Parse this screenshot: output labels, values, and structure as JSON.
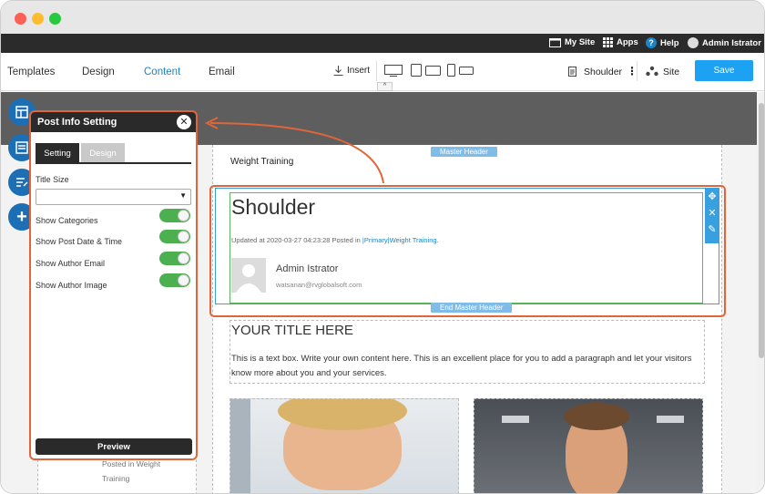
{
  "adminbar": {
    "mysite": "My Site",
    "apps": "Apps",
    "help": "Help",
    "user": "Admin Istrator"
  },
  "toolbar": {
    "tabs": [
      "Templates",
      "Design",
      "Content",
      "Email"
    ],
    "active_tab": "Content",
    "insert": "Insert",
    "page_name": "Shoulder",
    "site": "Site",
    "save": "Save"
  },
  "panel": {
    "title": "Post Info Setting",
    "tabs": [
      "Setting",
      "Design"
    ],
    "title_size_label": "Title Size",
    "title_size_value": "",
    "toggles": [
      {
        "label": "Show Categories",
        "on": true
      },
      {
        "label": "Show Post Date & Time",
        "on": true
      },
      {
        "label": "Show Author Email",
        "on": true
      },
      {
        "label": "Show Author Image",
        "on": true
      }
    ],
    "preview": "Preview"
  },
  "page": {
    "section_label": "Weight Training",
    "master_header": "Master Header",
    "end_master_header": "End Master Header",
    "post_title": "Shoulder",
    "meta_prefix": "Updated at 2020-03-27 04:23:28 Posted in",
    "meta_link": "|Primary|Weight Training.",
    "author_name": "Admin Istrator",
    "author_email": "watsanan@rvglobalsoft.com",
    "text_title": "YOUR TITLE HERE",
    "text_body": "This is a text box. Write your own content here. This is an excellent place for you to add a paragraph and let your visitors know more about you and your services.",
    "left_caption_1": "Posted in Weight",
    "left_caption_2": "Training"
  },
  "colors": {
    "accent": "#1c84c6",
    "highlight": "#e0663a",
    "toggle_on": "#4caf50",
    "save": "#1da1f2"
  }
}
